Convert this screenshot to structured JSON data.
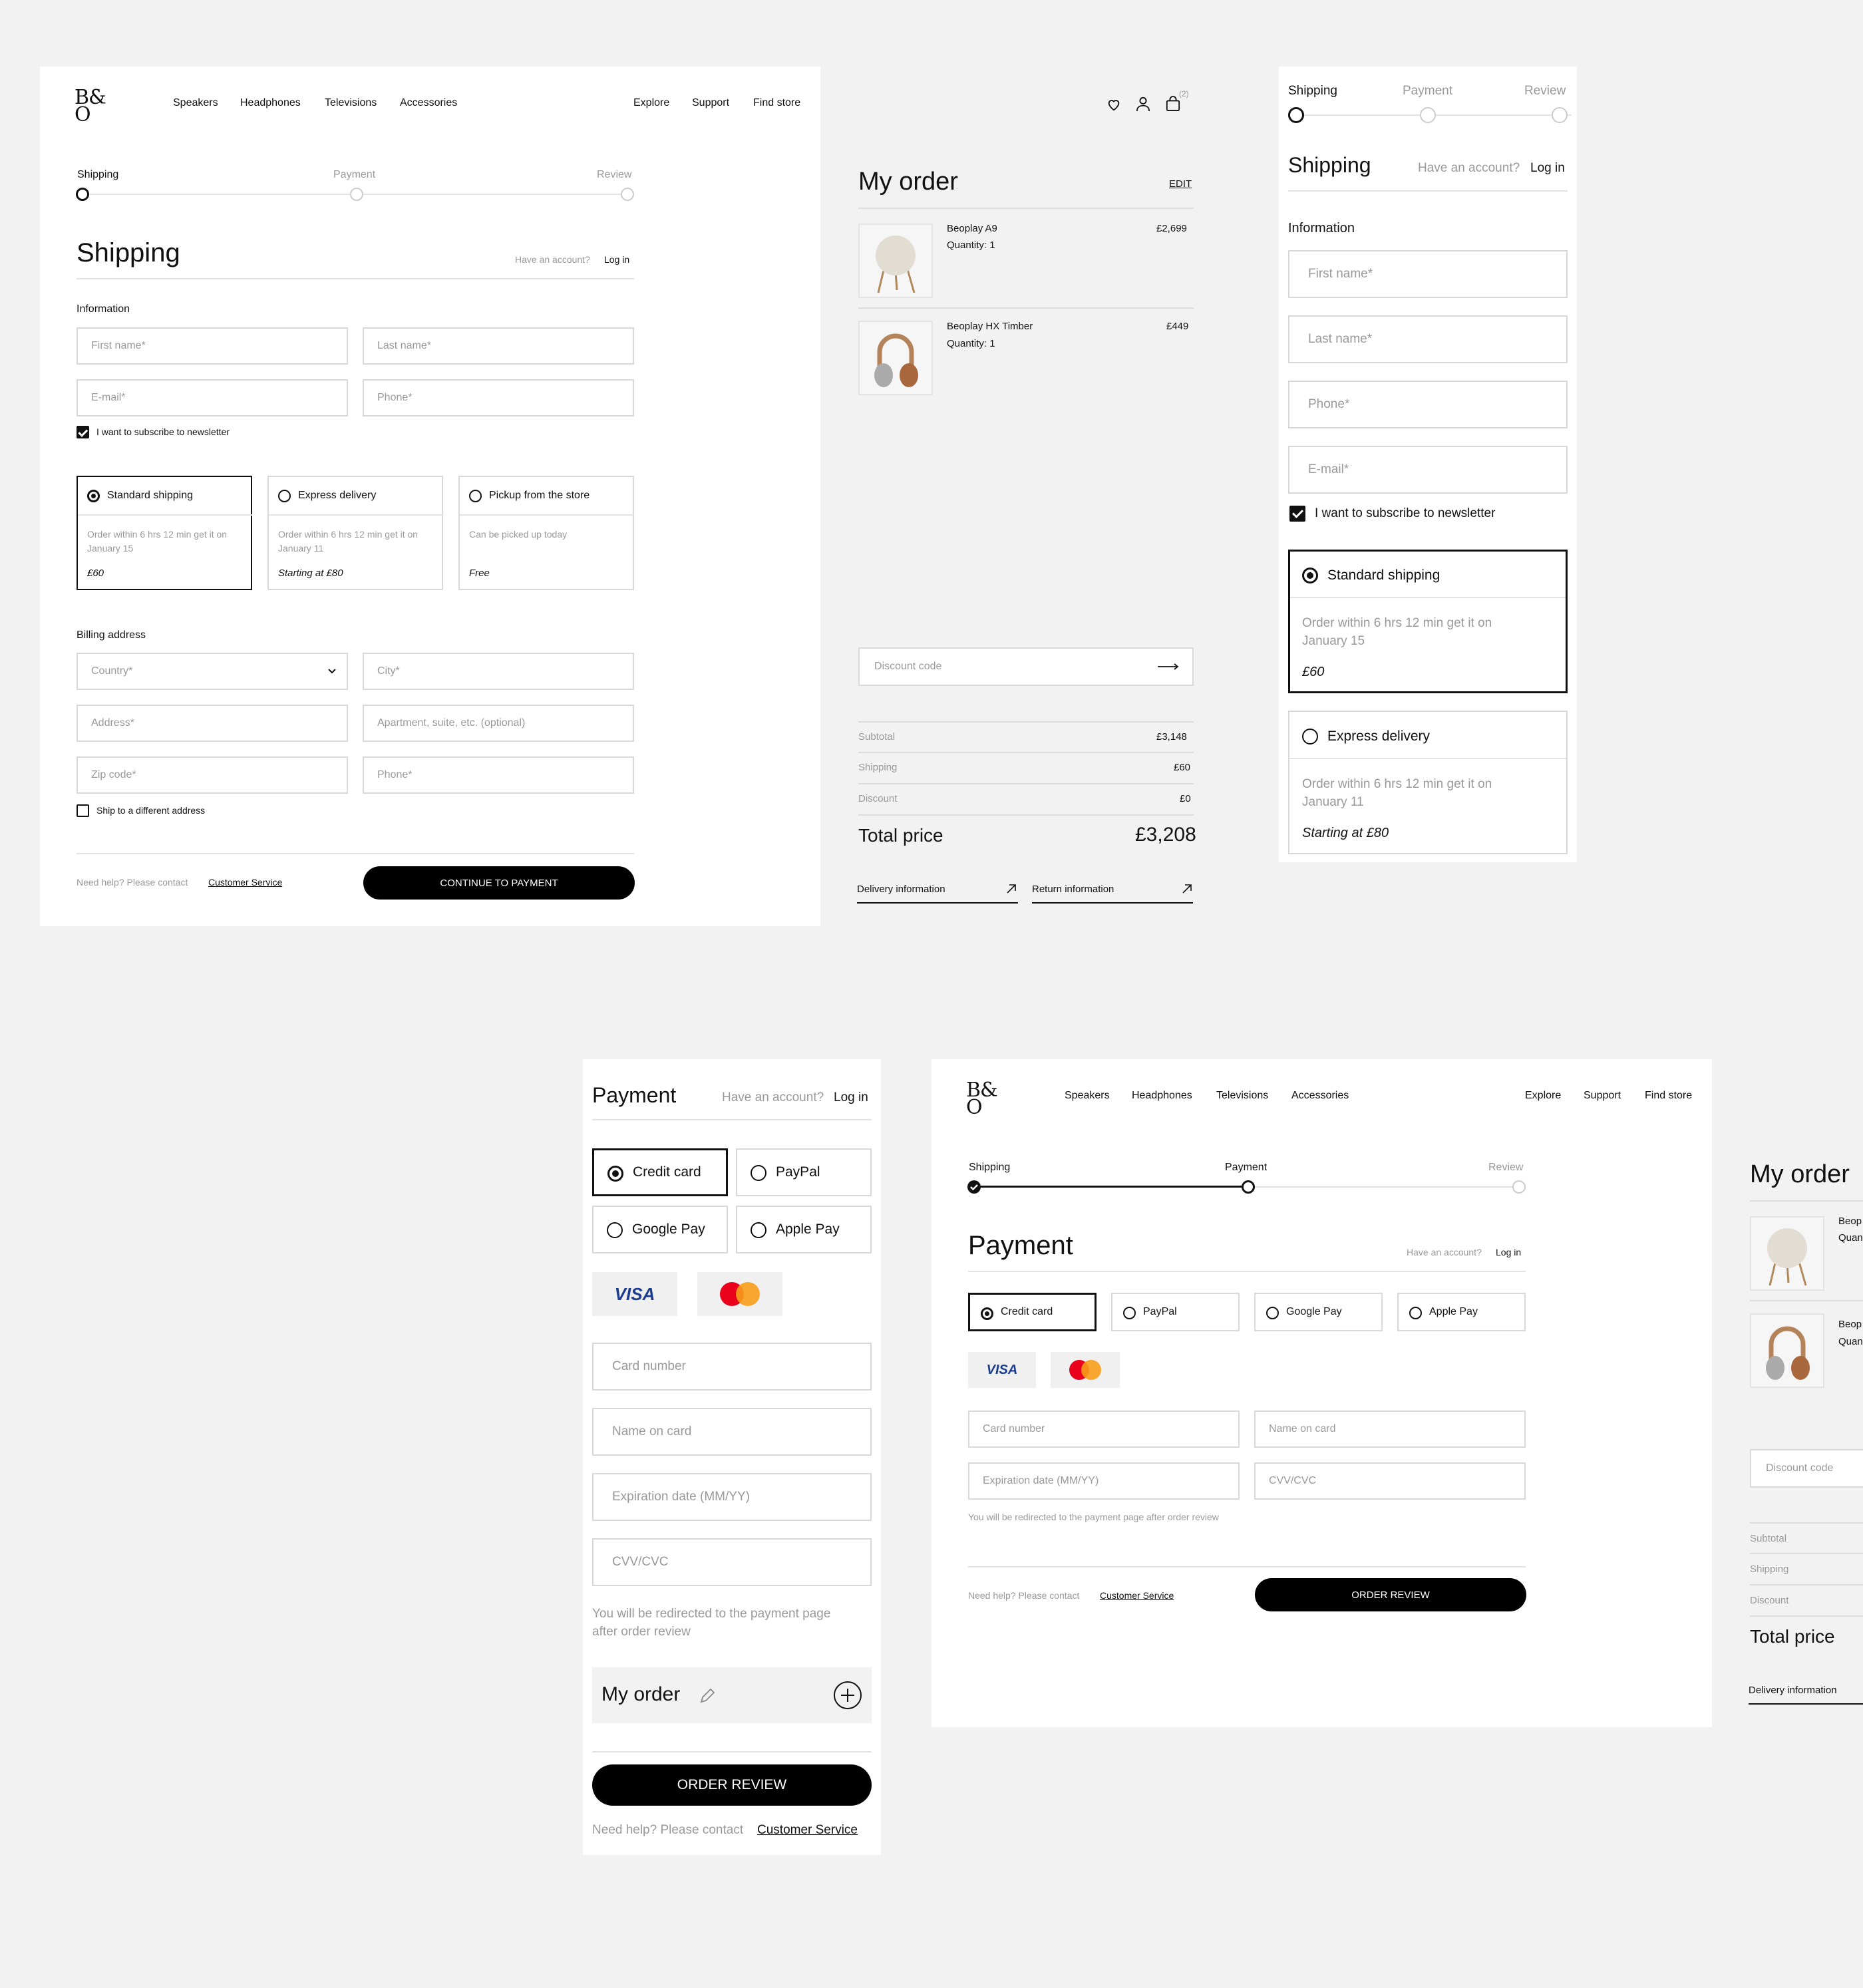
{
  "brand": {
    "logo_line1": "B&",
    "logo_line2": "O"
  },
  "nav": {
    "left": [
      "Speakers",
      "Headphones",
      "Televisions",
      "Accessories"
    ],
    "right": [
      "Explore",
      "Support",
      "Find store"
    ],
    "cart_count": "(2)"
  },
  "steps": [
    "Shipping",
    "Payment",
    "Review"
  ],
  "account": {
    "prompt": "Have an account?",
    "login": "Log in"
  },
  "shipping": {
    "title": "Shipping",
    "information": "Information",
    "first_name": "First name*",
    "last_name": "Last name*",
    "email": "E-mail*",
    "phone": "Phone*",
    "newsletter": "I want to subscribe to newsletter",
    "options": [
      {
        "label": "Standard shipping",
        "desc": "Order within 6 hrs 12 min get it on January 15",
        "price": "£60",
        "selected": true
      },
      {
        "label": "Express delivery",
        "desc": "Order within 6 hrs 12 min get it on January 11",
        "price": "Starting at £80",
        "selected": false
      },
      {
        "label": "Pickup from the store",
        "desc": "Can be picked up today",
        "price": "Free",
        "selected": false
      }
    ],
    "billing": "Billing address",
    "country": "Country*",
    "city": "City*",
    "address": "Address*",
    "apartment": "Apartment, suite, etc. (optional)",
    "zip": "Zip code*",
    "ship_different": "Ship to a different address",
    "continue": "CONTINUE TO PAYMENT"
  },
  "help": {
    "text": "Need help? Please contact",
    "link": "Customer Service"
  },
  "order": {
    "title": "My order",
    "edit": "EDIT",
    "items": [
      {
        "name": "Beoplay A9",
        "qty": "Quantity: 1",
        "price": "£2,699"
      },
      {
        "name": "Beoplay HX Timber",
        "qty": "Quantity: 1",
        "price": "£449"
      }
    ],
    "discount_placeholder": "Discount code",
    "subtotal_label": "Subtotal",
    "subtotal": "£3,148",
    "shipping_label": "Shipping",
    "shipping": "£60",
    "discount_label": "Discount",
    "discount": "£0",
    "total_label": "Total price",
    "total": "£3,208",
    "delivery_info": "Delivery information",
    "return_info": "Return information"
  },
  "payment": {
    "title": "Payment",
    "methods": [
      {
        "label": "Credit card",
        "selected": true
      },
      {
        "label": "PayPal",
        "selected": false
      },
      {
        "label": "Google Pay",
        "selected": false
      },
      {
        "label": "Apple Pay",
        "selected": false
      }
    ],
    "visa": "VISA",
    "card_number": "Card number",
    "name_on_card": "Name on card",
    "expiry": "Expiration date (MM/YY)",
    "cvv": "CVV/CVC",
    "redirect_note": "You will be redirected to the payment page after order review",
    "review_button": "ORDER REVIEW"
  },
  "mobile_order": {
    "title": "My order"
  },
  "partial": {
    "item1_name": "Beop",
    "item1_qty": "Quan",
    "item2_name": "Beop",
    "item2_qty": "Quan"
  },
  "colors": {
    "accent": "#000000",
    "border": "#d9d9d9",
    "canvas": "#f2f2f2",
    "visa_blue": "#1a3d8f",
    "mc_red": "#eb001b",
    "mc_orange": "#f79e1b"
  }
}
